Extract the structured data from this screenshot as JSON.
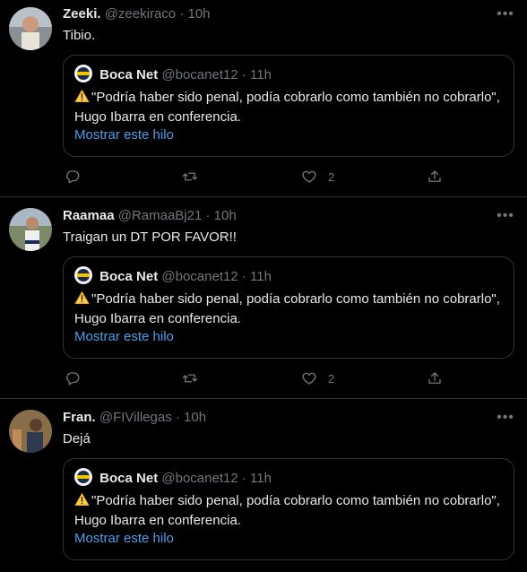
{
  "tweets": [
    {
      "name": "Zeeki.",
      "handle": "@zeekiraco",
      "time": "· 10h",
      "text": "Tibio.",
      "quote": {
        "name": "Boca Net",
        "handle": "@bocanet12",
        "time": "· 11h",
        "text": "\"Podría haber sido penal, podía cobrarlo como también no cobrarlo\", Hugo Ibarra en conferencia.",
        "link": "Mostrar este hilo"
      },
      "likes": "2"
    },
    {
      "name": "Raamaa",
      "handle": "@RamaaBj21",
      "time": "· 10h",
      "text": "Traigan un DT POR FAVOR!!",
      "quote": {
        "name": "Boca Net",
        "handle": "@bocanet12",
        "time": "· 11h",
        "text": "\"Podría haber sido penal, podía cobrarlo como también no cobrarlo\", Hugo Ibarra en conferencia.",
        "link": "Mostrar este hilo"
      },
      "likes": "2"
    },
    {
      "name": "Fran.",
      "handle": "@FIVillegas",
      "time": "· 10h",
      "text": "Dejá",
      "quote": {
        "name": "Boca Net",
        "handle": "@bocanet12",
        "time": "· 11h",
        "text": "\"Podría haber sido penal, podía cobrarlo como también no cobrarlo\", Hugo Ibarra en conferencia.",
        "link": "Mostrar este hilo"
      }
    }
  ],
  "icons": {
    "more": "more-icon",
    "reply": "reply-icon",
    "retweet": "retweet-icon",
    "like": "heart-icon",
    "share": "share-icon",
    "warning": "warning-icon"
  },
  "colors": {
    "background": "#000000",
    "text": "#e7e9ea",
    "muted": "#71767b",
    "link": "#4a9ee8",
    "border": "#2f3336"
  }
}
